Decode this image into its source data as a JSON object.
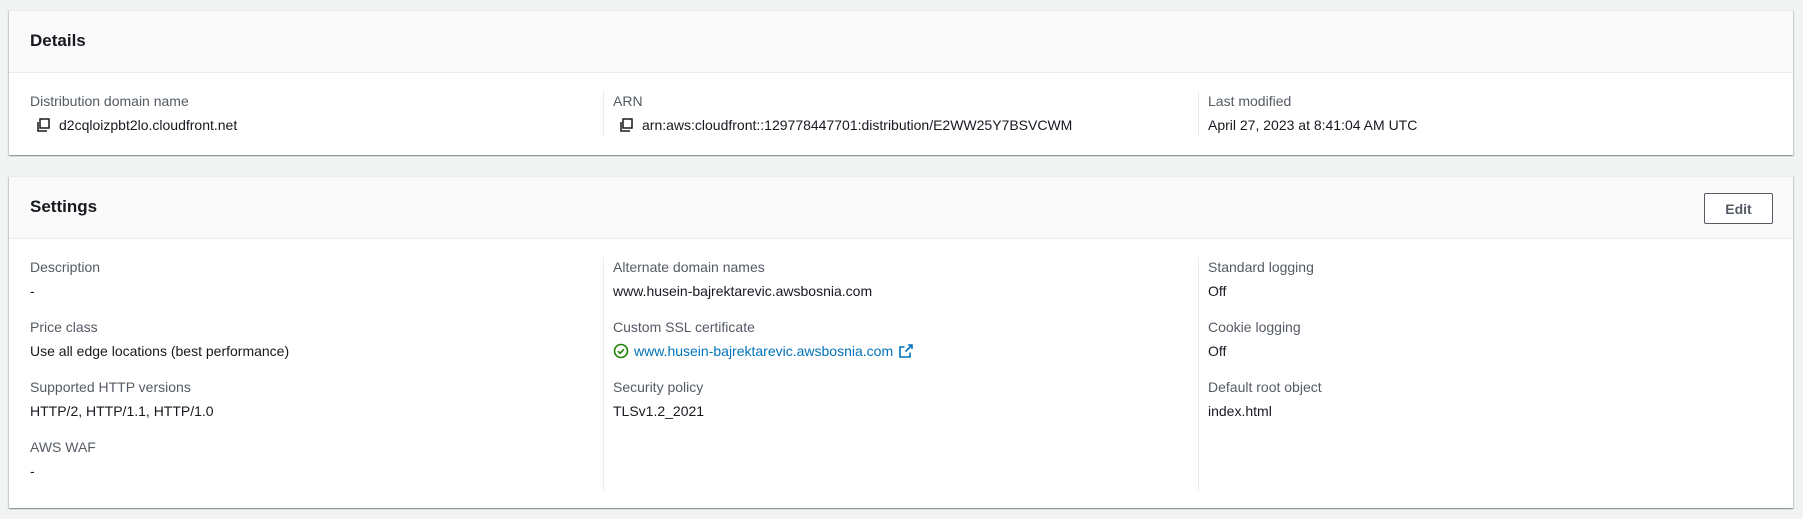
{
  "details": {
    "title": "Details",
    "distribution_domain_name": {
      "label": "Distribution domain name",
      "value": "d2cqloizpbt2lo.cloudfront.net"
    },
    "arn": {
      "label": "ARN",
      "value": "arn:aws:cloudfront::129778447701:distribution/E2WW25Y7BSVCWM"
    },
    "last_modified": {
      "label": "Last modified",
      "value": "April 27, 2023 at 8:41:04 AM UTC"
    }
  },
  "settings": {
    "title": "Settings",
    "edit_label": "Edit",
    "description": {
      "label": "Description",
      "value": "-"
    },
    "price_class": {
      "label": "Price class",
      "value": "Use all edge locations (best performance)"
    },
    "http_versions": {
      "label": "Supported HTTP versions",
      "value": "HTTP/2, HTTP/1.1, HTTP/1.0"
    },
    "aws_waf": {
      "label": "AWS WAF",
      "value": "-"
    },
    "alternate_domain_names": {
      "label": "Alternate domain names",
      "value": "www.husein-bajrektarevic.awsbosnia.com"
    },
    "custom_ssl_certificate": {
      "label": "Custom SSL certificate",
      "value": "www.husein-bajrektarevic.awsbosnia.com"
    },
    "security_policy": {
      "label": "Security policy",
      "value": "TLSv1.2_2021"
    },
    "standard_logging": {
      "label": "Standard logging",
      "value": "Off"
    },
    "cookie_logging": {
      "label": "Cookie logging",
      "value": "Off"
    },
    "default_root_object": {
      "label": "Default root object",
      "value": "index.html"
    }
  },
  "icons": {
    "copy": "copy-icon",
    "status_success": "status-positive-icon",
    "external_link": "external-link-icon"
  },
  "colors": {
    "link": "#0073bb",
    "success": "#1d8102",
    "label": "#545b64",
    "text": "#16191f",
    "background": "#f2f3f3"
  }
}
